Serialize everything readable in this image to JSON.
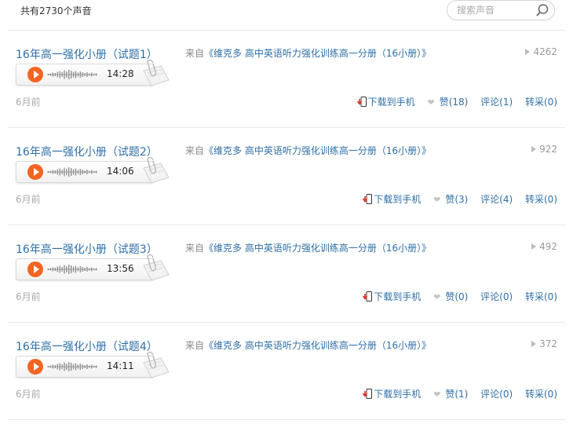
{
  "header": {
    "total_label": "共有2730个声音",
    "search_placeholder": "搜索声音"
  },
  "tracks": [
    {
      "title": "16年高一强化小册（试题1）",
      "duration": "14:28",
      "from_prefix": "来自",
      "album": "《维克多 高中英语听力强化训练高一分册（16小册）》",
      "plays": "4262",
      "ago": "6月前",
      "download": "下载到手机",
      "like": "赞(18)",
      "comment": "评论(1)",
      "repost": "转采(0)"
    },
    {
      "title": "16年高一强化小册（试题2）",
      "duration": "14:06",
      "from_prefix": "来自",
      "album": "《维克多 高中英语听力强化训练高一分册（16小册）》",
      "plays": "922",
      "ago": "6月前",
      "download": "下载到手机",
      "like": "赞(3)",
      "comment": "评论(4)",
      "repost": "转采(0)"
    },
    {
      "title": "16年高一强化小册（试题3）",
      "duration": "13:56",
      "from_prefix": "来自",
      "album": "《维克多 高中英语听力强化训练高一分册（16小册）》",
      "plays": "492",
      "ago": "6月前",
      "download": "下载到手机",
      "like": "赞(0)",
      "comment": "评论(0)",
      "repost": "转采(0)"
    },
    {
      "title": "16年高一强化小册（试题4）",
      "duration": "14:11",
      "from_prefix": "来自",
      "album": "《维克多 高中英语听力强化训练高一分册（16小册）》",
      "plays": "372",
      "ago": "6月前",
      "download": "下载到手机",
      "like": "赞(1)",
      "comment": "评论(0)",
      "repost": "转采(0)"
    }
  ],
  "colors": {
    "link": "#2e6fa7",
    "play_button": "#f26522",
    "muted": "#aaaaaa"
  },
  "icons": {
    "search": "search-icon",
    "play": "play-icon",
    "waveform": "waveform-icon",
    "paperclip": "paperclip-icon",
    "plays": "play-count-icon",
    "download": "download-phone-icon",
    "like": "heart-icon"
  }
}
